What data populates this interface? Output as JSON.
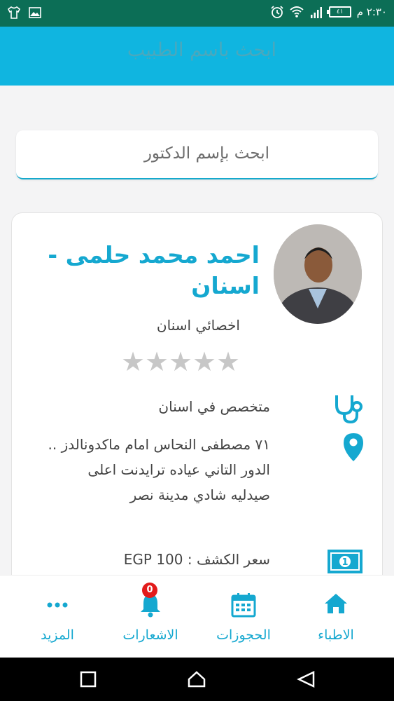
{
  "status_bar": {
    "time": "٢:٣٠ م",
    "battery": "٤١",
    "icons": [
      "shirt-icon",
      "image-icon",
      "alarm-icon",
      "wifi-icon",
      "signal-icon"
    ]
  },
  "app_bar": {
    "title": "ابحث باسم الطبيب"
  },
  "search": {
    "placeholder": "ابحث بإسم الدكتور"
  },
  "doctor": {
    "name": "احمد محمد حلمى - اسنان",
    "specialty_title": "اخصائي اسنان",
    "rating": 0,
    "rating_max": 5,
    "specialized_in": "متخصص في اسنان",
    "address": "٧١ مصطفى النحاس امام ماكدونالدز .. الدور التاني عياده ترايدنت اعلى صيدليه شادي مدينة نصر",
    "price": "سعر الكشف : EGP 100"
  },
  "bottom_nav": {
    "doctors": "الاطباء",
    "bookings": "الحجوزات",
    "notifications": "الاشعارات",
    "notifications_count": "0",
    "more": "المزيد"
  },
  "colors": {
    "accent": "#15a8d0",
    "status_bar": "#0c6e56",
    "app_bar": "#10b5e0",
    "badge": "#e21b1b"
  }
}
